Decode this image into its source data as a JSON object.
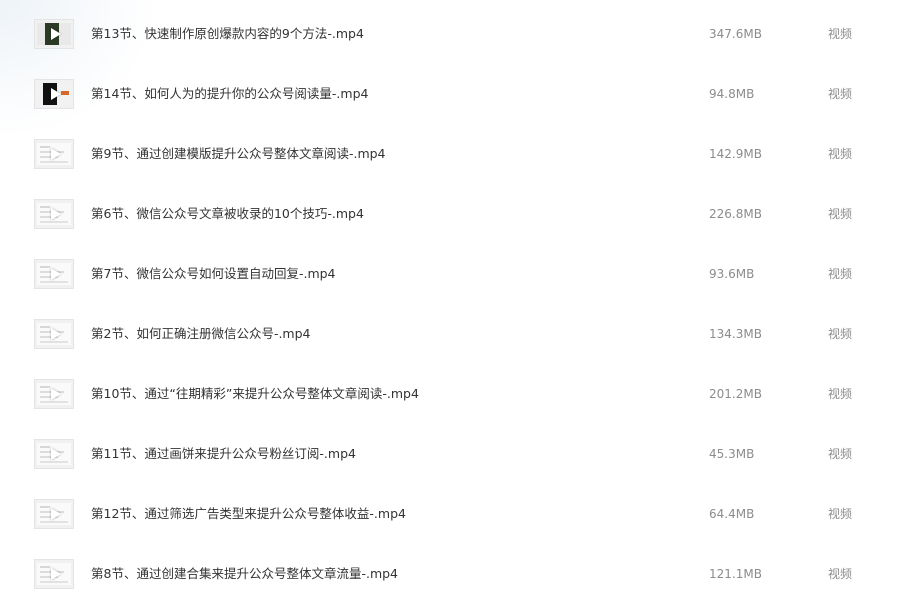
{
  "files": [
    {
      "name": "第13节、快速制作原创爆款内容的9个方法-.mp4",
      "size": "347.6MB",
      "type": "视频",
      "thumb": "dark",
      "icon": "video-thumbnail-icon"
    },
    {
      "name": "第14节、如何人为的提升你的公众号阅读量-.mp4",
      "size": "94.8MB",
      "type": "视频",
      "thumb": "black",
      "icon": "video-thumbnail-icon"
    },
    {
      "name": "第9节、通过创建模版提升公众号整体文章阅读-.mp4",
      "size": "142.9MB",
      "type": "视频",
      "thumb": "light",
      "icon": "video-thumbnail-icon"
    },
    {
      "name": "第6节、微信公众号文章被收录的10个技巧-.mp4",
      "size": "226.8MB",
      "type": "视频",
      "thumb": "light",
      "icon": "video-thumbnail-icon"
    },
    {
      "name": "第7节、微信公众号如何设置自动回复-.mp4",
      "size": "93.6MB",
      "type": "视频",
      "thumb": "light",
      "icon": "video-thumbnail-icon"
    },
    {
      "name": "第2节、如何正确注册微信公众号-.mp4",
      "size": "134.3MB",
      "type": "视频",
      "thumb": "light",
      "icon": "video-thumbnail-icon"
    },
    {
      "name": "第10节、通过“往期精彩”来提升公众号整体文章阅读-.mp4",
      "size": "201.2MB",
      "type": "视频",
      "thumb": "light",
      "icon": "video-thumbnail-icon"
    },
    {
      "name": "第11节、通过画饼来提升公众号粉丝订阅-.mp4",
      "size": "45.3MB",
      "type": "视频",
      "thumb": "light",
      "icon": "video-thumbnail-icon"
    },
    {
      "name": "第12节、通过筛选广告类型来提升公众号整体收益-.mp4",
      "size": "64.4MB",
      "type": "视频",
      "thumb": "light",
      "icon": "video-thumbnail-icon"
    },
    {
      "name": "第8节、通过创建合集来提升公众号整体文章流量-.mp4",
      "size": "121.1MB",
      "type": "视频",
      "thumb": "light",
      "icon": "video-thumbnail-icon"
    }
  ]
}
